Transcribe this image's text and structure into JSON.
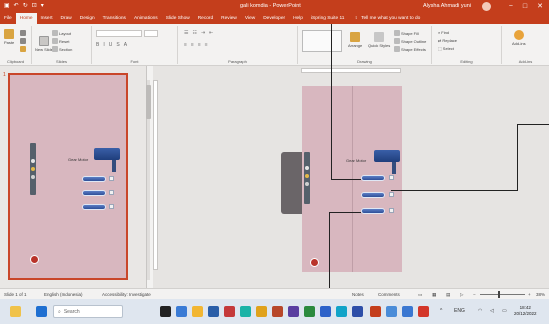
{
  "title_bar": {
    "document_title": "gali komdia - PowerPoint",
    "user_name": "Alysha Ahmadi yuni",
    "window_controls": [
      "−",
      "□",
      "✕"
    ]
  },
  "tabs": [
    {
      "label": "File",
      "active": false
    },
    {
      "label": "Home",
      "active": true
    },
    {
      "label": "Insert",
      "active": false
    },
    {
      "label": "Draw",
      "active": false
    },
    {
      "label": "Design",
      "active": false
    },
    {
      "label": "Transitions",
      "active": false
    },
    {
      "label": "Animations",
      "active": false
    },
    {
      "label": "Slide Show",
      "active": false
    },
    {
      "label": "Record",
      "active": false
    },
    {
      "label": "Review",
      "active": false
    },
    {
      "label": "View",
      "active": false
    },
    {
      "label": "Developer",
      "active": false
    },
    {
      "label": "Help",
      "active": false
    },
    {
      "label": "iSpring Suite 11",
      "active": false
    }
  ],
  "tell_me": {
    "placeholder": "Tell me what you want to do"
  },
  "ribbon": {
    "groups": [
      {
        "label": "Clipboard"
      },
      {
        "label": "Slides"
      },
      {
        "label": "Font"
      },
      {
        "label": "Paragraph"
      },
      {
        "label": "Drawing"
      },
      {
        "label": "Editing"
      },
      {
        "label": "Add-ins"
      }
    ],
    "clipboard": {
      "paste": "Paste"
    },
    "slides": {
      "new_slide": "New Slide",
      "layout": "Layout",
      "reset": "Reset",
      "section": "Section"
    },
    "drawing": {
      "arrange": "Arrange",
      "quick_styles": "Quick Styles",
      "shape_fill": "Shape Fill",
      "shape_outline": "Shape Outline",
      "shape_effects": "Shape Effects"
    },
    "editing": {
      "find": "Find",
      "replace": "Replace",
      "select": "Select"
    },
    "addins": {
      "label": "Add-ins"
    }
  },
  "thumbnails": [
    {
      "number": "1",
      "selected": true
    }
  ],
  "slide": {
    "title_text": "Gear Motor"
  },
  "status_bar": {
    "slide_info": "Slide 1 of 1",
    "language": "English (Indonesia)",
    "accessibility": "Accessibility: Investigate",
    "notes": "Notes",
    "comments": "Comments",
    "zoom": "38%"
  },
  "taskbar": {
    "search_placeholder": "Search",
    "tray_language": "ENG",
    "clock_time": "18:42",
    "clock_date": "20/12/2022"
  },
  "colors": {
    "brand": "#c43e1c",
    "slide_bg": "#d8b7bf",
    "pill_blue": "#2e4f98"
  }
}
